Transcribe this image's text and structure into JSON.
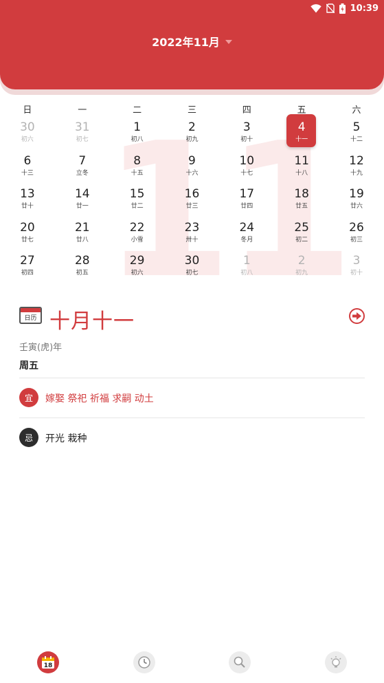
{
  "status_bar": {
    "time": "10:39"
  },
  "header": {
    "month_title": "2022年11月"
  },
  "watermark": "11",
  "weekdays": [
    "日",
    "一",
    "二",
    "三",
    "四",
    "五",
    "六"
  ],
  "calendar": {
    "weeks": [
      [
        {
          "num": "30",
          "lunar": "初六",
          "dim": true
        },
        {
          "num": "31",
          "lunar": "初七",
          "dim": true
        },
        {
          "num": "1",
          "lunar": "初八"
        },
        {
          "num": "2",
          "lunar": "初九"
        },
        {
          "num": "3",
          "lunar": "初十"
        },
        {
          "num": "4",
          "lunar": "十一",
          "today": true
        },
        {
          "num": "5",
          "lunar": "十二"
        }
      ],
      [
        {
          "num": "6",
          "lunar": "十三"
        },
        {
          "num": "7",
          "lunar": "立冬"
        },
        {
          "num": "8",
          "lunar": "十五"
        },
        {
          "num": "9",
          "lunar": "十六"
        },
        {
          "num": "10",
          "lunar": "十七"
        },
        {
          "num": "11",
          "lunar": "十八"
        },
        {
          "num": "12",
          "lunar": "十九"
        }
      ],
      [
        {
          "num": "13",
          "lunar": "廿十"
        },
        {
          "num": "14",
          "lunar": "廿一"
        },
        {
          "num": "15",
          "lunar": "廿二"
        },
        {
          "num": "16",
          "lunar": "廿三"
        },
        {
          "num": "17",
          "lunar": "廿四"
        },
        {
          "num": "18",
          "lunar": "廿五"
        },
        {
          "num": "19",
          "lunar": "廿六"
        }
      ],
      [
        {
          "num": "20",
          "lunar": "廿七"
        },
        {
          "num": "21",
          "lunar": "廿八"
        },
        {
          "num": "22",
          "lunar": "小雪"
        },
        {
          "num": "23",
          "lunar": "卅十"
        },
        {
          "num": "24",
          "lunar": "冬月"
        },
        {
          "num": "25",
          "lunar": "初二"
        },
        {
          "num": "26",
          "lunar": "初三"
        }
      ],
      [
        {
          "num": "27",
          "lunar": "初四"
        },
        {
          "num": "28",
          "lunar": "初五"
        },
        {
          "num": "29",
          "lunar": "初六"
        },
        {
          "num": "30",
          "lunar": "初七"
        },
        {
          "num": "1",
          "lunar": "初八",
          "dim": true
        },
        {
          "num": "2",
          "lunar": "初九",
          "dim": true
        },
        {
          "num": "3",
          "lunar": "初十",
          "dim": true
        }
      ]
    ]
  },
  "detail": {
    "icon_label": "日历",
    "lunar_date": "十月十一",
    "year": "壬寅(虎)年",
    "weekday": "周五",
    "good_badge": "宜",
    "good_items": "嫁娶 祭祀 祈福 求嗣 动土",
    "bad_badge": "忌",
    "bad_items": "开光 栽种"
  },
  "bottom_nav": {
    "calendar_icon_day": "18"
  },
  "colors": {
    "primary": "#d13c3e",
    "header_shadow": "#f0d9d9"
  }
}
